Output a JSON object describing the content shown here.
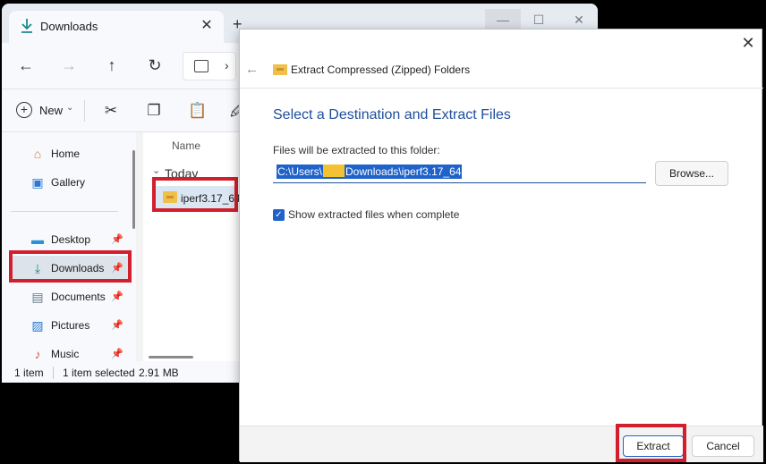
{
  "explorer": {
    "tab_title": "Downloads",
    "tab_add": "+",
    "new_label": "New",
    "column_name": "Name",
    "group_label": "Today",
    "file_name": "iperf3.17_64",
    "sidebar": {
      "items": [
        {
          "label": "Home",
          "icon": "home-icon"
        },
        {
          "label": "Gallery",
          "icon": "gallery-icon"
        },
        {
          "label": "Desktop",
          "icon": "desktop-icon"
        },
        {
          "label": "Downloads",
          "icon": "download-icon"
        },
        {
          "label": "Documents",
          "icon": "documents-icon"
        },
        {
          "label": "Pictures",
          "icon": "pictures-icon"
        },
        {
          "label": "Music",
          "icon": "music-icon"
        }
      ]
    },
    "status": {
      "item_count": "1 item",
      "selected": "1 item selected",
      "size": "2.91 MB"
    }
  },
  "dialog": {
    "caption": "Extract Compressed (Zipped) Folders",
    "heading": "Select a Destination and Extract Files",
    "path_label": "Files will be extracted to this folder:",
    "path_prefix": "C:\\Users\\",
    "path_suffix": "Downloads\\iperf3.17_64",
    "browse_label": "Browse...",
    "checkbox_label": "Show extracted files when complete",
    "checkbox_checked": true,
    "extract_label": "Extract",
    "cancel_label": "Cancel"
  },
  "colors": {
    "highlight": "#d11f2e",
    "accent": "#1f62c9",
    "heading": "#1f4e9a"
  }
}
